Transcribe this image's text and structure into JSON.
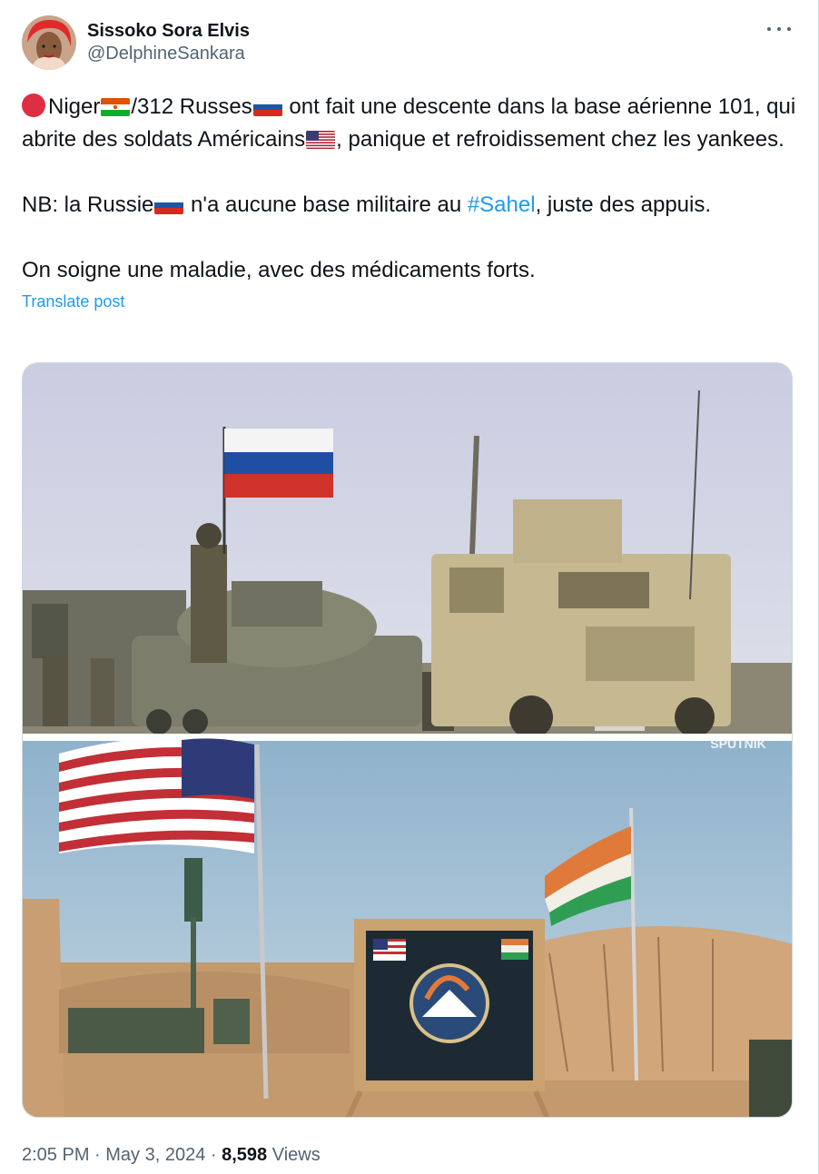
{
  "author": {
    "display_name": "Sissoko Sora Elvis",
    "handle": "@DelphineSankara"
  },
  "post": {
    "line1_a": "Niger",
    "line1_b": "/312 Russes",
    "line1_c": " ont fait une descente dans la base aérienne 101, qui abrite des soldats Américains",
    "line1_d": ", panique et refroidissement chez les yankees.",
    "line2_a": "NB: la Russie",
    "line2_b": " n'a aucune base militaire au ",
    "line2_hashtag": "#Sahel",
    "line2_c": ", juste des appuis.",
    "line3": "On soigne une maladie, avec des médicaments forts."
  },
  "translate_label": "Translate post",
  "media": {
    "watermark": "SPUTNIK",
    "alt": "Russian and American military vehicles; US and Niger flags at an air base"
  },
  "meta": {
    "time": "2:05 PM",
    "date": "May 3, 2024",
    "views_count": "8,598",
    "views_label": "Views",
    "separator": " · "
  },
  "colors": {
    "link": "#1d9bf0",
    "secondary_text": "#536471",
    "primary_text": "#0f1419"
  },
  "icons": [
    "more-options-icon",
    "red-circle-emoji",
    "niger-flag-emoji",
    "russia-flag-emoji",
    "usa-flag-emoji"
  ]
}
